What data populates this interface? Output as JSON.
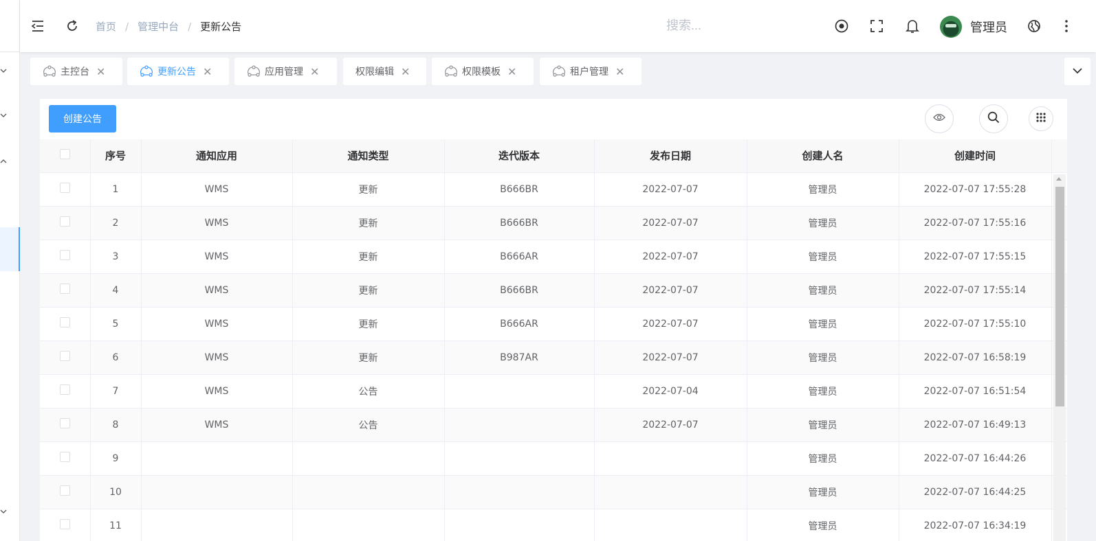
{
  "header": {
    "breadcrumb": [
      "首页",
      "管理中台",
      "更新公告"
    ],
    "search_placeholder": "搜索...",
    "username": "管理员"
  },
  "tags": [
    {
      "label": "主控台",
      "active": false,
      "icon": "tag-icon"
    },
    {
      "label": "更新公告",
      "active": true,
      "icon": "tag-icon"
    },
    {
      "label": "应用管理",
      "active": false,
      "icon": "tag-icon"
    },
    {
      "label": "权限编辑",
      "active": false,
      "icon": ""
    },
    {
      "label": "权限模板",
      "active": false,
      "icon": "tag-icon"
    },
    {
      "label": "租户管理",
      "active": false,
      "icon": "tag-icon"
    }
  ],
  "toolbar": {
    "create_label": "创建公告"
  },
  "table": {
    "columns": [
      "序号",
      "通知应用",
      "通知类型",
      "迭代版本",
      "发布日期",
      "创建人名",
      "创建时间"
    ],
    "rows": [
      [
        "1",
        "WMS",
        "更新",
        "B666BR",
        "2022-07-07",
        "管理员",
        "2022-07-07 17:55:28"
      ],
      [
        "2",
        "WMS",
        "更新",
        "B666BR",
        "2022-07-07",
        "管理员",
        "2022-07-07 17:55:16"
      ],
      [
        "3",
        "WMS",
        "更新",
        "B666AR",
        "2022-07-07",
        "管理员",
        "2022-07-07 17:55:15"
      ],
      [
        "4",
        "WMS",
        "更新",
        "B666BR",
        "2022-07-07",
        "管理员",
        "2022-07-07 17:55:14"
      ],
      [
        "5",
        "WMS",
        "更新",
        "B666AR",
        "2022-07-07",
        "管理员",
        "2022-07-07 17:55:10"
      ],
      [
        "6",
        "WMS",
        "更新",
        "B987AR",
        "2022-07-07",
        "管理员",
        "2022-07-07 16:58:19"
      ],
      [
        "7",
        "WMS",
        "公告",
        "",
        "2022-07-04",
        "管理员",
        "2022-07-07 16:51:54"
      ],
      [
        "8",
        "WMS",
        "公告",
        "",
        "2022-07-07",
        "管理员",
        "2022-07-07 16:49:13"
      ],
      [
        "9",
        "",
        "",
        "",
        "",
        "管理员",
        "2022-07-07 16:44:26"
      ],
      [
        "10",
        "",
        "",
        "",
        "",
        "管理员",
        "2022-07-07 16:44:25"
      ],
      [
        "11",
        "",
        "",
        "",
        "",
        "管理员",
        "2022-07-07 16:34:19"
      ]
    ]
  },
  "colors": {
    "primary": "#409eff",
    "header_bg": "#ffffff",
    "page_bg": "#f0f2f5"
  }
}
